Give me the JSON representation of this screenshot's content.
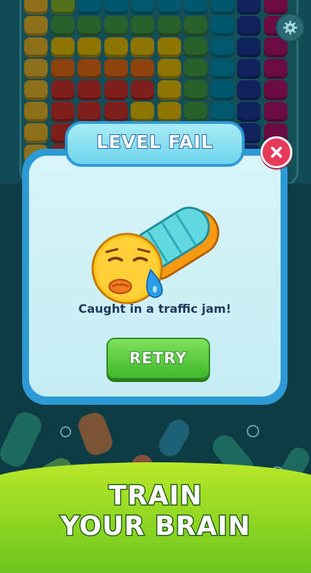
{
  "dialog": {
    "title": "LEVEL FAIL",
    "message": "Caught in a traffic jam!",
    "retry_label": "RETRY"
  },
  "promo": {
    "line1": "TRAIN",
    "line2": "YOUR BRAIN"
  },
  "board": {
    "columns": [
      [
        "#ffcc33",
        "#ffcc33",
        "#ffcc33",
        "#ffcc33",
        "#ffcc33",
        "#ffcc33",
        "#ffcc33",
        "#ffcc33",
        "#ffcc33"
      ],
      [
        "#9acd32",
        "#4caf50",
        "#ffd400",
        "#ff7a1a",
        "#e53935",
        "#e53935",
        "#e53935",
        "#e53935",
        "#e53935"
      ],
      [
        "#00a0c8",
        "#4caf50",
        "#ffd400",
        "#ff7a1a",
        "#e53935",
        "#e53935",
        "#e53935",
        "#e53935",
        "#e53935"
      ],
      [
        "#00a0c8",
        "#4caf50",
        "#ffd400",
        "#ff7a1a",
        "#e53935",
        "#e53935",
        "#ffd400",
        "#ffd400",
        "#ffd400"
      ],
      [
        "#00a0c8",
        "#4caf50",
        "#ffd400",
        "#ff7a1a",
        "#e53935",
        "#ffd400",
        "#ffd400",
        "#ffd400",
        "#ffd400"
      ],
      [
        "#00a0c8",
        "#4caf50",
        "#ffd400",
        "#ffd400",
        "#ffd400",
        "#ffd400",
        "#ffd400",
        "#ffd400",
        "#ffd400"
      ],
      [
        "#00a0c8",
        "#4caf50",
        "#4caf50",
        "#4caf50",
        "#4caf50",
        "#4caf50",
        "#4caf50",
        "#4caf50",
        "#4caf50"
      ],
      [
        "#00a0c8",
        "#00a0c8",
        "#00a0c8",
        "#00a0c8",
        "#00a0c8",
        "#00a0c8",
        "#00a0c8",
        "#00a0c8",
        "#00a0c8"
      ],
      [
        "#1e3fa8",
        "#1e3fa8",
        "#1e3fa8",
        "#1e3fa8",
        "#1e3fa8",
        "#1e3fa8",
        "#1e3fa8",
        "#1e3fa8",
        "#1e3fa8"
      ],
      [
        "#c2187a",
        "#c2187a",
        "#c2187a",
        "#c2187a",
        "#c2187a",
        "#c2187a",
        "#c2187a",
        "#c2187a",
        "#c2187a"
      ]
    ]
  },
  "icons": {
    "settings": "gear-icon",
    "close": "close-icon",
    "mascot": "sad-car-mascot"
  },
  "colors": {
    "dialog_border": "#2d9ad6",
    "close_button": "#e8395a",
    "retry_button": "#4cc236",
    "promo_green": "#8fd423"
  }
}
